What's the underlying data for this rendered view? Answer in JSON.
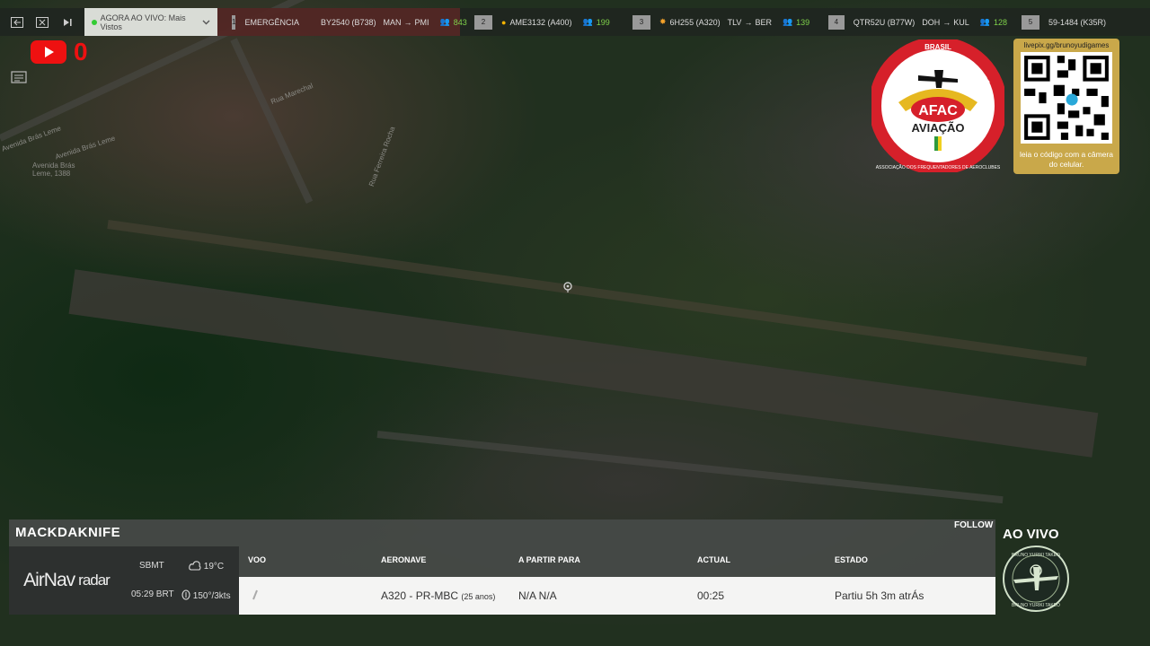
{
  "topbar": {
    "now_label": "AGORA AO VIVO: Mais Vistos",
    "flights": [
      {
        "rank": "1",
        "label": "EMERGÊNCIA",
        "callsign": "BY2540 (B738)",
        "route_from": "MAN",
        "route_to": "PMI",
        "viewers": "843",
        "emergency": true
      },
      {
        "rank": "2",
        "label": "",
        "callsign": "AME3132 (A400)",
        "route_from": "",
        "route_to": "",
        "viewers": "199",
        "emergency": false
      },
      {
        "rank": "3",
        "label": "",
        "callsign": "6H255 (A320)",
        "route_from": "TLV",
        "route_to": "BER",
        "viewers": "139",
        "emergency": false
      },
      {
        "rank": "4",
        "label": "",
        "callsign": "QTR52U (B77W)",
        "route_from": "DOH",
        "route_to": "KUL",
        "viewers": "128",
        "emergency": false
      },
      {
        "rank": "5",
        "label": "",
        "callsign": "59-1484 (K35R)",
        "route_from": "",
        "route_to": "",
        "viewers": "",
        "emergency": false
      }
    ]
  },
  "youtube": {
    "count": "0"
  },
  "map": {
    "labels": [
      "Avenida Brás Leme",
      "Avenida Brás Leme",
      "Avenida Brás Leme, 1388",
      "Rua Marechal",
      "Rua Ferreira Rocha"
    ]
  },
  "afac": {
    "top_text": "BRASIL",
    "side_text": "AVIAÇÃO",
    "brand": "AFAC",
    "subtitle": "AVIAÇÃO",
    "ring_text": "ASSOCIAÇÃO DOS FREQUENTADORES DE AEROCLUBES"
  },
  "qr": {
    "url": "livepix.gg/brunoyudigames",
    "caption": "leia o código com a câmera do celular."
  },
  "panel": {
    "username": "MACKDAKNIFE",
    "follow": "FOLLOW",
    "brand_main": "AirNav",
    "brand_sub": "radar",
    "airport_code": "SBMT",
    "local_time": "05:29 BRT",
    "temperature": "19°C",
    "wind": "150°/3kts",
    "headers": {
      "voo": "VOO",
      "aeronave": "AERONAVE",
      "rota": "A PARTIR PARA",
      "actual": "ACTUAL",
      "estado": "ESTADO"
    },
    "row": {
      "aircraft": "A320 - PR-MBC",
      "age": "(25 anos)",
      "route": "N/A N/A",
      "actual": "00:25",
      "status": "Partiu 5h 3m atrÁs"
    }
  },
  "live": {
    "label": "AO VIVO",
    "badge_top": "BRUNO YURIKI TAKEO",
    "badge_bottom": "BRUNO YURIKI TAKEO"
  }
}
